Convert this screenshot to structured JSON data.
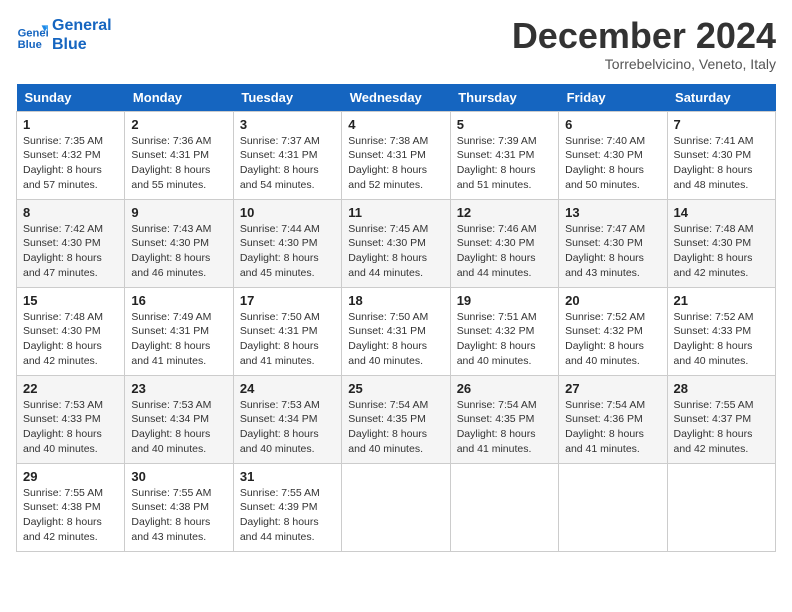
{
  "logo": {
    "line1": "General",
    "line2": "Blue"
  },
  "header": {
    "month": "December 2024",
    "location": "Torrebelvicino, Veneto, Italy"
  },
  "weekdays": [
    "Sunday",
    "Monday",
    "Tuesday",
    "Wednesday",
    "Thursday",
    "Friday",
    "Saturday"
  ],
  "weeks": [
    [
      {
        "day": 1,
        "rise": "7:35 AM",
        "set": "4:32 PM",
        "daylight": "8 hours and 57 minutes."
      },
      {
        "day": 2,
        "rise": "7:36 AM",
        "set": "4:31 PM",
        "daylight": "8 hours and 55 minutes."
      },
      {
        "day": 3,
        "rise": "7:37 AM",
        "set": "4:31 PM",
        "daylight": "8 hours and 54 minutes."
      },
      {
        "day": 4,
        "rise": "7:38 AM",
        "set": "4:31 PM",
        "daylight": "8 hours and 52 minutes."
      },
      {
        "day": 5,
        "rise": "7:39 AM",
        "set": "4:31 PM",
        "daylight": "8 hours and 51 minutes."
      },
      {
        "day": 6,
        "rise": "7:40 AM",
        "set": "4:30 PM",
        "daylight": "8 hours and 50 minutes."
      },
      {
        "day": 7,
        "rise": "7:41 AM",
        "set": "4:30 PM",
        "daylight": "8 hours and 48 minutes."
      }
    ],
    [
      {
        "day": 8,
        "rise": "7:42 AM",
        "set": "4:30 PM",
        "daylight": "8 hours and 47 minutes."
      },
      {
        "day": 9,
        "rise": "7:43 AM",
        "set": "4:30 PM",
        "daylight": "8 hours and 46 minutes."
      },
      {
        "day": 10,
        "rise": "7:44 AM",
        "set": "4:30 PM",
        "daylight": "8 hours and 45 minutes."
      },
      {
        "day": 11,
        "rise": "7:45 AM",
        "set": "4:30 PM",
        "daylight": "8 hours and 44 minutes."
      },
      {
        "day": 12,
        "rise": "7:46 AM",
        "set": "4:30 PM",
        "daylight": "8 hours and 44 minutes."
      },
      {
        "day": 13,
        "rise": "7:47 AM",
        "set": "4:30 PM",
        "daylight": "8 hours and 43 minutes."
      },
      {
        "day": 14,
        "rise": "7:48 AM",
        "set": "4:30 PM",
        "daylight": "8 hours and 42 minutes."
      }
    ],
    [
      {
        "day": 15,
        "rise": "7:48 AM",
        "set": "4:30 PM",
        "daylight": "8 hours and 42 minutes."
      },
      {
        "day": 16,
        "rise": "7:49 AM",
        "set": "4:31 PM",
        "daylight": "8 hours and 41 minutes."
      },
      {
        "day": 17,
        "rise": "7:50 AM",
        "set": "4:31 PM",
        "daylight": "8 hours and 41 minutes."
      },
      {
        "day": 18,
        "rise": "7:50 AM",
        "set": "4:31 PM",
        "daylight": "8 hours and 40 minutes."
      },
      {
        "day": 19,
        "rise": "7:51 AM",
        "set": "4:32 PM",
        "daylight": "8 hours and 40 minutes."
      },
      {
        "day": 20,
        "rise": "7:52 AM",
        "set": "4:32 PM",
        "daylight": "8 hours and 40 minutes."
      },
      {
        "day": 21,
        "rise": "7:52 AM",
        "set": "4:33 PM",
        "daylight": "8 hours and 40 minutes."
      }
    ],
    [
      {
        "day": 22,
        "rise": "7:53 AM",
        "set": "4:33 PM",
        "daylight": "8 hours and 40 minutes."
      },
      {
        "day": 23,
        "rise": "7:53 AM",
        "set": "4:34 PM",
        "daylight": "8 hours and 40 minutes."
      },
      {
        "day": 24,
        "rise": "7:53 AM",
        "set": "4:34 PM",
        "daylight": "8 hours and 40 minutes."
      },
      {
        "day": 25,
        "rise": "7:54 AM",
        "set": "4:35 PM",
        "daylight": "8 hours and 40 minutes."
      },
      {
        "day": 26,
        "rise": "7:54 AM",
        "set": "4:35 PM",
        "daylight": "8 hours and 41 minutes."
      },
      {
        "day": 27,
        "rise": "7:54 AM",
        "set": "4:36 PM",
        "daylight": "8 hours and 41 minutes."
      },
      {
        "day": 28,
        "rise": "7:55 AM",
        "set": "4:37 PM",
        "daylight": "8 hours and 42 minutes."
      }
    ],
    [
      {
        "day": 29,
        "rise": "7:55 AM",
        "set": "4:38 PM",
        "daylight": "8 hours and 42 minutes."
      },
      {
        "day": 30,
        "rise": "7:55 AM",
        "set": "4:38 PM",
        "daylight": "8 hours and 43 minutes."
      },
      {
        "day": 31,
        "rise": "7:55 AM",
        "set": "4:39 PM",
        "daylight": "8 hours and 44 minutes."
      },
      null,
      null,
      null,
      null
    ]
  ]
}
